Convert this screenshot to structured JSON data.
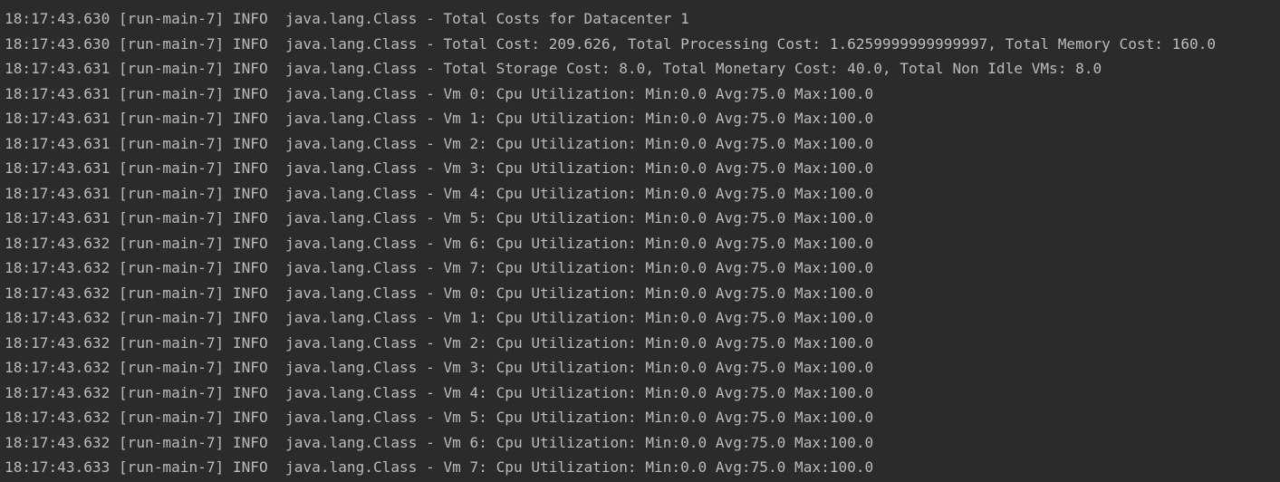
{
  "console": {
    "lines": [
      "18:17:43.630 [run-main-7] INFO  java.lang.Class - Total Costs for Datacenter 1",
      "18:17:43.630 [run-main-7] INFO  java.lang.Class - Total Cost: 209.626, Total Processing Cost: 1.6259999999999997, Total Memory Cost: 160.0",
      "18:17:43.631 [run-main-7] INFO  java.lang.Class - Total Storage Cost: 8.0, Total Monetary Cost: 40.0, Total Non Idle VMs: 8.0",
      "18:17:43.631 [run-main-7] INFO  java.lang.Class - Vm 0: Cpu Utilization: Min:0.0 Avg:75.0 Max:100.0",
      "18:17:43.631 [run-main-7] INFO  java.lang.Class - Vm 1: Cpu Utilization: Min:0.0 Avg:75.0 Max:100.0",
      "18:17:43.631 [run-main-7] INFO  java.lang.Class - Vm 2: Cpu Utilization: Min:0.0 Avg:75.0 Max:100.0",
      "18:17:43.631 [run-main-7] INFO  java.lang.Class - Vm 3: Cpu Utilization: Min:0.0 Avg:75.0 Max:100.0",
      "18:17:43.631 [run-main-7] INFO  java.lang.Class - Vm 4: Cpu Utilization: Min:0.0 Avg:75.0 Max:100.0",
      "18:17:43.631 [run-main-7] INFO  java.lang.Class - Vm 5: Cpu Utilization: Min:0.0 Avg:75.0 Max:100.0",
      "18:17:43.632 [run-main-7] INFO  java.lang.Class - Vm 6: Cpu Utilization: Min:0.0 Avg:75.0 Max:100.0",
      "18:17:43.632 [run-main-7] INFO  java.lang.Class - Vm 7: Cpu Utilization: Min:0.0 Avg:75.0 Max:100.0",
      "18:17:43.632 [run-main-7] INFO  java.lang.Class - Vm 0: Cpu Utilization: Min:0.0 Avg:75.0 Max:100.0",
      "18:17:43.632 [run-main-7] INFO  java.lang.Class - Vm 1: Cpu Utilization: Min:0.0 Avg:75.0 Max:100.0",
      "18:17:43.632 [run-main-7] INFO  java.lang.Class - Vm 2: Cpu Utilization: Min:0.0 Avg:75.0 Max:100.0",
      "18:17:43.632 [run-main-7] INFO  java.lang.Class - Vm 3: Cpu Utilization: Min:0.0 Avg:75.0 Max:100.0",
      "18:17:43.632 [run-main-7] INFO  java.lang.Class - Vm 4: Cpu Utilization: Min:0.0 Avg:75.0 Max:100.0",
      "18:17:43.632 [run-main-7] INFO  java.lang.Class - Vm 5: Cpu Utilization: Min:0.0 Avg:75.0 Max:100.0",
      "18:17:43.632 [run-main-7] INFO  java.lang.Class - Vm 6: Cpu Utilization: Min:0.0 Avg:75.0 Max:100.0",
      "18:17:43.633 [run-main-7] INFO  java.lang.Class - Vm 7: Cpu Utilization: Min:0.0 Avg:75.0 Max:100.0"
    ]
  },
  "colors": {
    "background": "#2b2b2b",
    "text": "#bbbbbb"
  }
}
